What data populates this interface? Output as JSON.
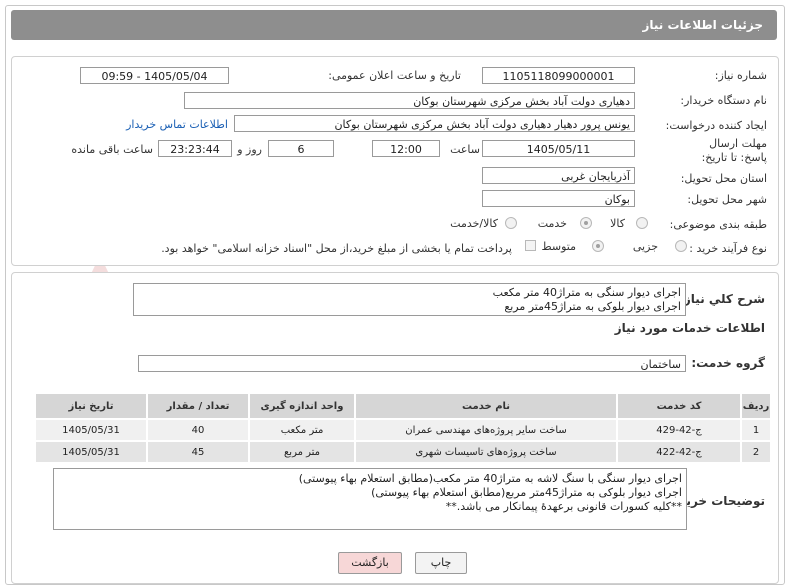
{
  "header": {
    "title": "جزئیات اطلاعات نیاز"
  },
  "fields": {
    "need_number_label": "شماره نیاز:",
    "need_number": "1105118099000001",
    "announce_label": "تاریخ و ساعت اعلان عمومی:",
    "announce_value": "1405/05/04 - 09:59",
    "buyer_org_label": "نام دستگاه خریدار:",
    "buyer_org": "دهیاری دولت آباد بخش مرکزی شهرستان بوکان",
    "creator_label": "ایجاد کننده درخواست:",
    "creator": "یونس پرور دهیار دهیاری دولت آباد بخش مرکزی شهرستان بوکان",
    "contact_link": "اطلاعات تماس خریدار",
    "deadline_label": "مهلت ارسال پاسخ: تا تاریخ:",
    "deadline_date": "1405/05/11",
    "time_label": "ساعت",
    "deadline_time": "12:00",
    "days_value": "6",
    "days_label": "روز و",
    "remaining_time": "23:23:44",
    "remaining_label": "ساعت باقی مانده",
    "province_label": "استان محل تحویل:",
    "province": "آذربایجان غربی",
    "city_label": "شهر محل تحویل:",
    "city": "بوکان",
    "category_label": "طبقه بندی موضوعی:",
    "category_options": [
      "کالا",
      "خدمت",
      "کالا/خدمت"
    ],
    "process_label": "نوع فرآیند خرید :",
    "process_options": [
      "جزیی",
      "متوسط"
    ],
    "payment_note": "پرداخت تمام یا بخشی از مبلغ خرید،از محل \"اسناد خزانه اسلامی\" خواهد بود."
  },
  "summary": {
    "label": "شرح کلي نياز:",
    "lines": [
      "اجرای دیوار سنگی به متراژ40 متر مکعب",
      "اجرای دیوار بلوکی به متراژ45متر مربع"
    ]
  },
  "services": {
    "title": "اطلاعات خدمات مورد نیاز",
    "group_label": "گروه خدمت:",
    "group_value": "ساختمان",
    "columns": [
      "ردیف",
      "کد خدمت",
      "نام خدمت",
      "واحد اندازه گیری",
      "تعداد / مقدار",
      "تاریخ نیاز"
    ],
    "rows": [
      [
        "1",
        "ج-42-429",
        "ساخت سایر پروژه‌های مهندسی عمران",
        "متر مکعب",
        "40",
        "1405/05/31"
      ],
      [
        "2",
        "ج-42-422",
        "ساخت پروژه‌های تاسیسات شهری",
        "متر مربع",
        "45",
        "1405/05/31"
      ]
    ]
  },
  "notes": {
    "label": "توضیحات خریدار:",
    "lines": [
      "اجرای دیوار سنگی با سنگ لاشه به متراژ40 متر مکعب(مطابق استعلام بهاء پیوستی)",
      "اجرای دیوار بلوکی به متراژ45متر مربع(مطابق استعلام بهاء پیوستی)",
      "**کلیه کسورات قانونی برعهدهٔ پیمانکار می باشد.**"
    ]
  },
  "buttons": {
    "print": "چاپ",
    "back": "بازگشت"
  },
  "watermark": "AriaTender.neT",
  "colors": {
    "title_bg": "#8e8e8e",
    "link": "#1a5fb4",
    "back_button_bg": "#f7d7d7",
    "table_header": "#d6d6d6"
  }
}
